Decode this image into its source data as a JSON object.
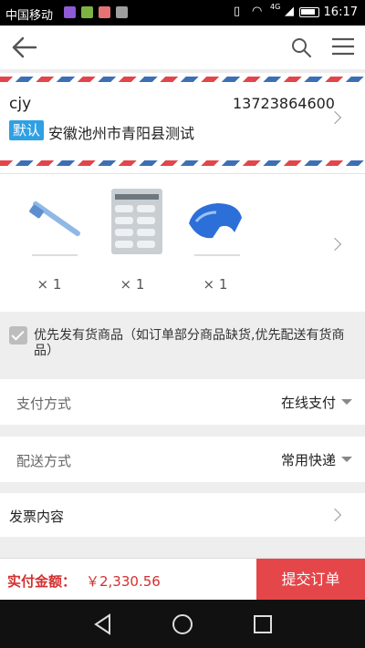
{
  "statusbar": {
    "carrier": "中国移动",
    "network": "4G",
    "time": "16:17",
    "notification_icons": [
      "#8e5ad6",
      "#7cb342",
      "#e57373",
      "#9e9e9e"
    ]
  },
  "navbar": {
    "back_icon": "arrow-left-icon",
    "search_icon": "search-icon",
    "menu_icon": "menu-icon"
  },
  "address": {
    "name": "cjy",
    "phone": "13723864600",
    "default_tag": "默认",
    "address": "安徽池州市青阳县测试"
  },
  "products": {
    "items": [
      {
        "type": "toothbrush",
        "qty": "× 1"
      },
      {
        "type": "blister-pack",
        "qty": "× 1"
      },
      {
        "type": "blue-clip",
        "qty": "× 1"
      }
    ]
  },
  "stock_option": {
    "checked": true,
    "text": "优先发有货商品（如订单部分商品缺货,优先配送有货商品）"
  },
  "payment": {
    "label": "支付方式",
    "value": "在线支付"
  },
  "delivery": {
    "label": "配送方式",
    "value": "常用快递"
  },
  "invoice": {
    "label": "发票内容"
  },
  "footer": {
    "total_label": "实付金额：",
    "total_value": "￥2,330.56",
    "submit_label": "提交订单"
  },
  "colors": {
    "accent_red": "#e5464a",
    "tag_blue": "#2fa0e4"
  }
}
